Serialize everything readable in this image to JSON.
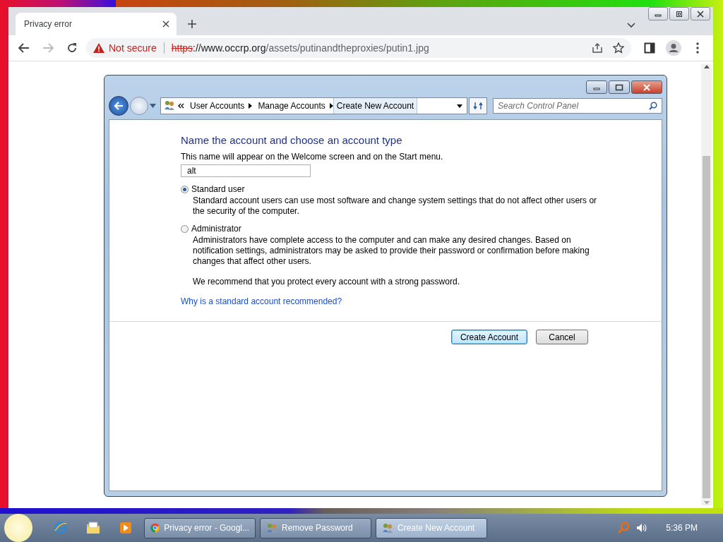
{
  "browser": {
    "tabs": [
      {
        "title": "Privacy error",
        "selected": true
      }
    ],
    "address": {
      "security": "Not secure",
      "scheme": "https",
      "host": "://www.occrp.org",
      "path": "/assets/putinandtheproxies/putin1.jpg"
    }
  },
  "dialog": {
    "breadcrumb": [
      {
        "label": "User Accounts"
      },
      {
        "label": "Manage Accounts"
      },
      {
        "label": "Create New Account"
      }
    ],
    "search": {
      "placeholder": "Search Control Panel"
    },
    "heading": "Name the account and choose an account type",
    "prompt": "This name will appear on the Welcome screen and on the Start menu.",
    "name_value": "alt",
    "options": [
      {
        "label": "Standard user",
        "selected": true,
        "description": "Standard account users can use most software and change system settings that do not affect other users or the security of the computer."
      },
      {
        "label": "Administrator",
        "selected": false,
        "description": "Administrators have complete access to the computer and can make any desired changes. Based on notification settings, administrators may be asked to provide their password or confirmation before making changes that affect other users."
      }
    ],
    "recommendation": "We recommend that you protect every account with a strong password.",
    "link": "Why is a standard account recommended?",
    "buttons": [
      {
        "label": "Create Account",
        "kind": "default"
      },
      {
        "label": "Cancel",
        "kind": "normal"
      }
    ]
  },
  "taskbar": {
    "pinned": [
      {
        "kind": "ie"
      },
      {
        "kind": "folder"
      },
      {
        "kind": "media"
      }
    ],
    "windows": [
      {
        "label": "Privacy error - Googl...",
        "kind": "chrome",
        "selected": false
      },
      {
        "label": "Remove Password",
        "kind": "users",
        "selected": false
      },
      {
        "label": "Create New Account",
        "kind": "users",
        "selected": true
      }
    ],
    "clock": "5:36 PM"
  }
}
